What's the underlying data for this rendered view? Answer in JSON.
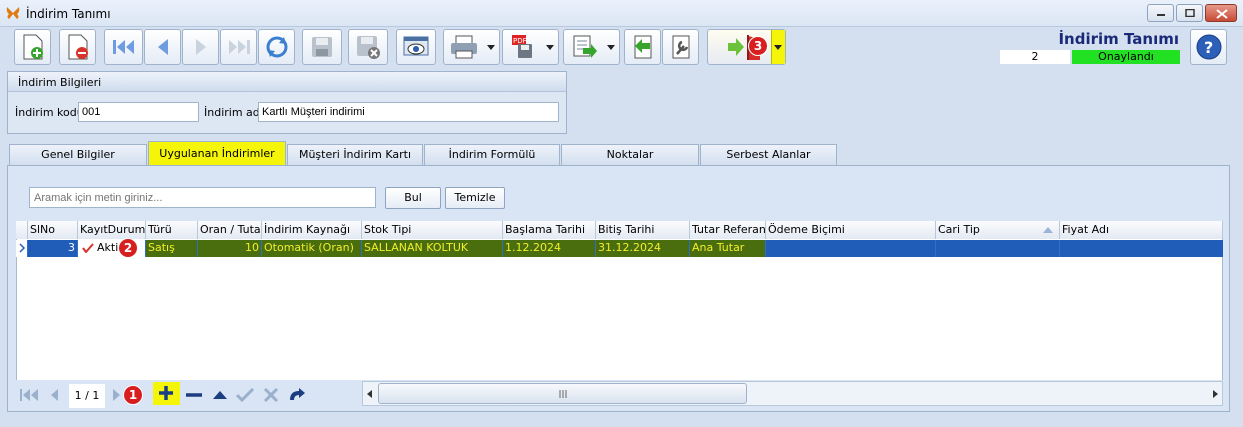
{
  "window": {
    "title": "İndirim Tanımı"
  },
  "header": {
    "title": "İndirim Tanımı",
    "record_no": "2",
    "status": "Onaylandı",
    "status_color": "#22e022"
  },
  "info": {
    "group_title": "İndirim Bilgileri",
    "code_label": "İndirim kodu",
    "code_value": "001",
    "name_label": "İndirim adı",
    "name_value": "Kartlı Müşteri indirimi"
  },
  "tabs": [
    "Genel Bilgiler",
    "Uygulanan İndirimler",
    "Müşteri İndirim Kartı",
    "İndirim Formülü",
    "Noktalar",
    "Serbest Alanlar"
  ],
  "search": {
    "placeholder": "Aramak için metin giriniz...",
    "find_label": "Bul",
    "clear_label": "Temizle"
  },
  "grid": {
    "columns": [
      "SlNo",
      "KayıtDurumu",
      "Türü",
      "Oran / Tutar",
      "İndirim Kaynağı",
      "Stok Tipi",
      "Başlama Tarihi",
      "Bitiş Tarihi",
      "Tutar Referans",
      "Ödeme Biçimi",
      "Cari Tip",
      "Fiyat Adı"
    ],
    "row": {
      "slno": "3",
      "status": "Aktif",
      "type": "Satış",
      "rate": "10",
      "source": "Otomatik (Oran)",
      "stock_type": "SALLANAN KOLTUK",
      "start": "1.12.2024",
      "end": "31.12.2024",
      "amount_ref": "Ana Tutar"
    }
  },
  "nav": {
    "page": "1 / 1"
  },
  "badges": [
    "1",
    "2",
    "3"
  ],
  "colors": {
    "selected_row": "#1f5db8",
    "row_cell_bg": "#4a6d0e",
    "row_cell_text": "#f2ef2a",
    "highlight": "#f5f50a"
  }
}
